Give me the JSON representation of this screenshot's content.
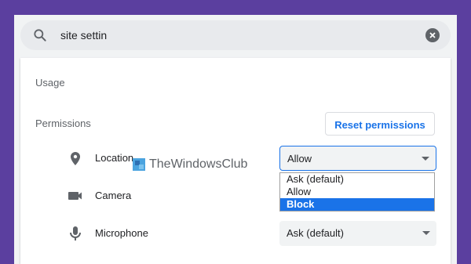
{
  "search": {
    "value": "site settin"
  },
  "sections": {
    "usage": "Usage",
    "permissions": "Permissions"
  },
  "reset_button": "Reset permissions",
  "rows": {
    "location": {
      "label": "Location",
      "icon": "location-pin-icon",
      "value": "Allow"
    },
    "camera": {
      "label": "Camera",
      "icon": "camera-icon"
    },
    "microphone": {
      "label": "Microphone",
      "icon": "microphone-icon",
      "value": "Ask (default)"
    }
  },
  "dropdown": {
    "options": [
      "Ask (default)",
      "Allow",
      "Block"
    ],
    "highlighted": "Block"
  },
  "watermark": "TheWindowsClub",
  "colors": {
    "accent": "#1a73e8",
    "background": "#5b3f9f"
  }
}
